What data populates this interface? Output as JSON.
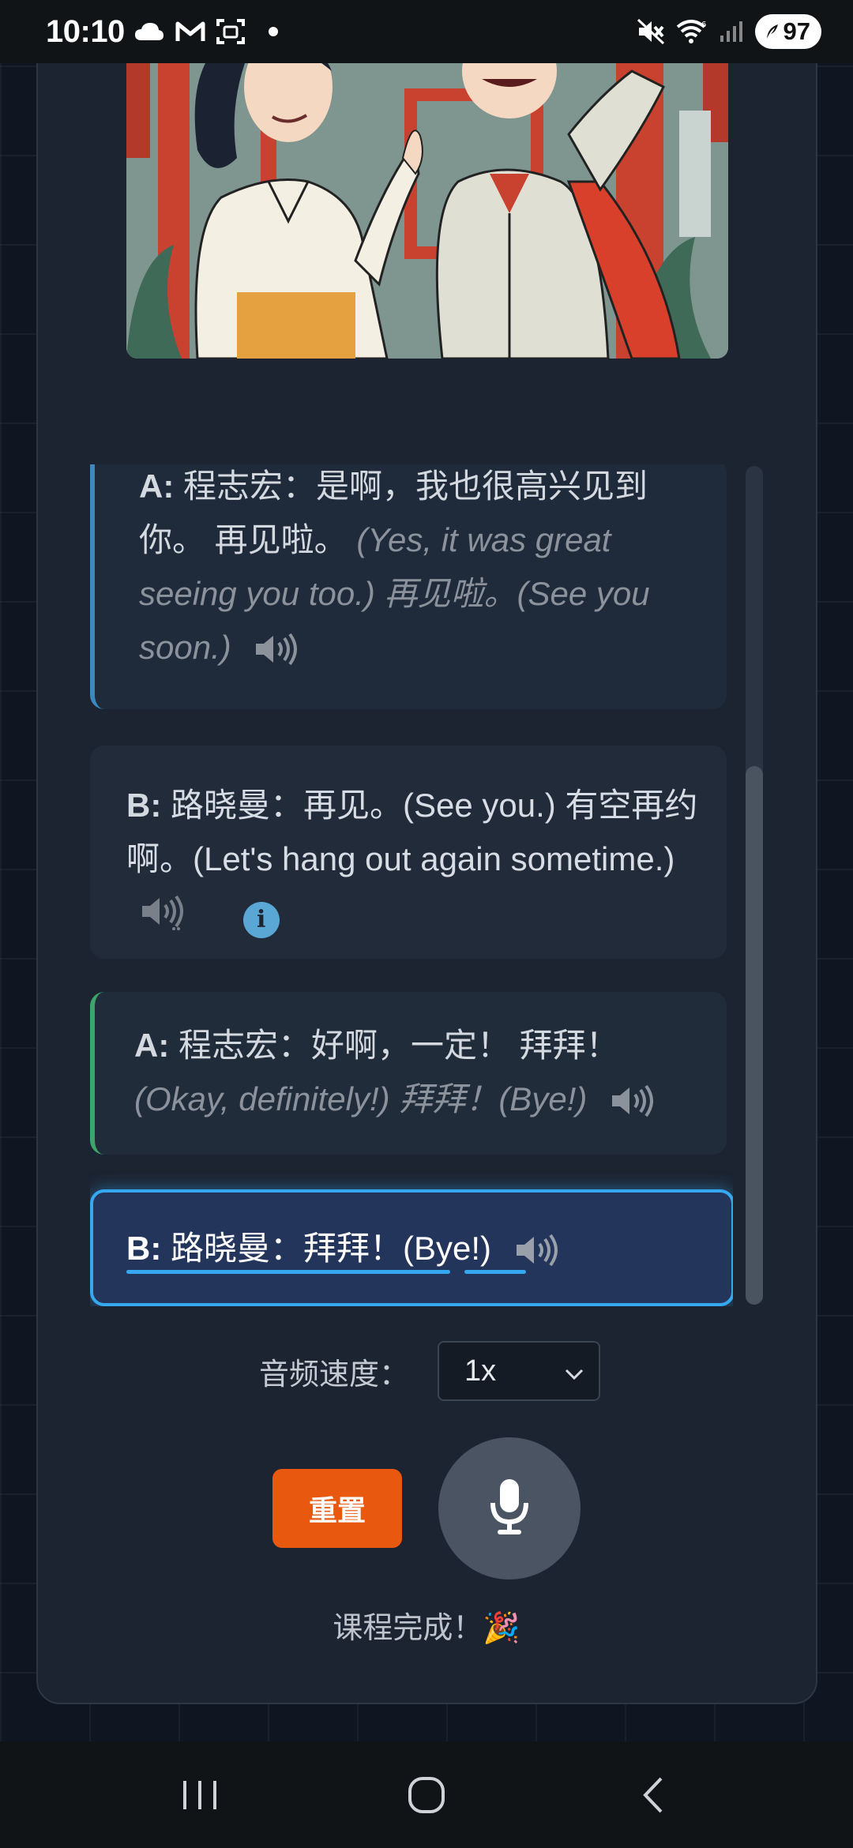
{
  "status_bar": {
    "time": "10:10",
    "battery": "97",
    "icons": [
      "cloud-icon",
      "gmail-icon",
      "screenshot-icon",
      "notification-dot-icon",
      "mute-icon",
      "wifi-icon",
      "signal-icon",
      "battery-icon"
    ]
  },
  "dialogue": {
    "lines": [
      {
        "speaker": "A:",
        "text": "程志宏：是啊，我也很高兴见到你。 再见啦。",
        "translation": "(Yes, it was great seeing you too.) 再见啦。(See you soon.)"
      },
      {
        "speaker": "B:",
        "text": "路晓曼：再见。(See you.) 有空再约啊。(Let's hang out again sometime.)"
      },
      {
        "speaker": "A:",
        "text": "程志宏：好啊，一定！ 拜拜！",
        "translation": "(Okay, definitely!) 拜拜！(Bye!)"
      },
      {
        "speaker": "B:",
        "text": "路晓曼：拜拜！(Bye!)"
      }
    ]
  },
  "controls": {
    "speed_label": "音频速度：",
    "speed_value": "1x",
    "reset_label": "重置",
    "complete_text": "课程完成！🎉"
  },
  "colors": {
    "accent_blue": "#35a8f0",
    "accent_green": "#3ba56a",
    "reset_orange": "#e8580f",
    "card_bg": "#1c2431"
  }
}
